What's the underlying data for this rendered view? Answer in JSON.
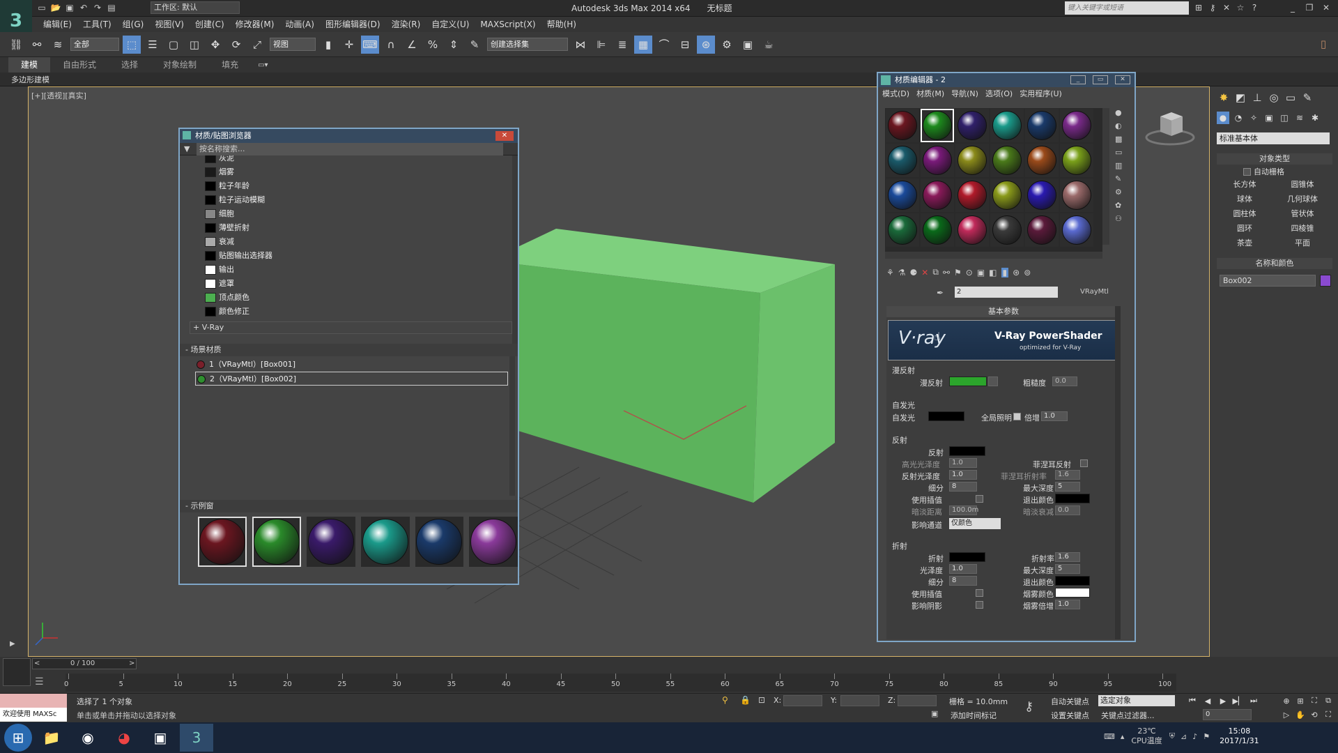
{
  "app": {
    "title": "Autodesk 3ds Max  2014 x64",
    "document": "无标题",
    "workspace": "工作区: 默认",
    "search_placeholder": "键入关键字或短语"
  },
  "menu": [
    "编辑(E)",
    "工具(T)",
    "组(G)",
    "视图(V)",
    "创建(C)",
    "修改器(M)",
    "动画(A)",
    "图形编辑器(D)",
    "渲染(R)",
    "自定义(U)",
    "MAXScript(X)",
    "帮助(H)"
  ],
  "toolbar": {
    "filter_select": "全部",
    "view_select": "视图",
    "named_selection": "创建选择集"
  },
  "ribbon": {
    "tabs": [
      "建模",
      "自由形式",
      "选择",
      "对象绘制",
      "填充"
    ],
    "active": "建模",
    "subtitle": "多边形建模"
  },
  "viewport": {
    "label": "[+][透视][真实]"
  },
  "browser": {
    "title": "材质/贴图浏览器",
    "search_placeholder": "按名称搜索...",
    "maps": [
      {
        "name": "灰泥",
        "swatch": "#111111"
      },
      {
        "name": "烟雾",
        "swatch": "#1a1a1a"
      },
      {
        "name": "粒子年龄",
        "swatch": "#000000"
      },
      {
        "name": "粒子运动模糊",
        "swatch": "#000000"
      },
      {
        "name": "细胞",
        "swatch": "#888888"
      },
      {
        "name": "薄壁折射",
        "swatch": "#000000"
      },
      {
        "name": "衰减",
        "swatch": "#aaaaaa"
      },
      {
        "name": "贴图输出选择器",
        "swatch": "#000000"
      },
      {
        "name": "输出",
        "swatch": "#ffffff"
      },
      {
        "name": "遮罩",
        "swatch": "#ffffff"
      },
      {
        "name": "顶点颜色",
        "swatch": "#4caf50"
      },
      {
        "name": "颜色修正",
        "swatch": "#000000"
      }
    ],
    "vray_group": "+ V-Ray",
    "scene_group": "- 场景材质",
    "scene_materials": [
      {
        "label": "1（VRayMtl）[Box001]",
        "color": "#7a1f2a"
      },
      {
        "label": "2（VRayMtl）[Box002]",
        "color": "#2f8f2f"
      }
    ],
    "sample_group": "- 示例窗",
    "sample_colors": [
      "#6b1620",
      "#2a8a2a",
      "#3a1a6a",
      "#1a9a8a",
      "#1a3a6a",
      "#8a3a9a"
    ]
  },
  "medit": {
    "title": "材质编辑器 - 2",
    "menu": [
      "模式(D)",
      "材质(M)",
      "导航(N)",
      "选项(O)",
      "实用程序(U)"
    ],
    "slots": [
      "#6b1620",
      "#1d8a1d",
      "#30206a",
      "#1a9a8a",
      "#1a3a6a",
      "#7a2a8a",
      "#1a5a6a",
      "#7a1a7a",
      "#8a8a1a",
      "#4a7a1a",
      "#9a4a1a",
      "#7aa01a",
      "#1a4a9a",
      "#8a1a5a",
      "#b01a2a",
      "#8a9a1a",
      "#2a1ab0",
      "#9a6a6a",
      "#1a6a3a",
      "#0a6a1a",
      "#c02a5a",
      "#3a3a3a",
      "#5a1a3a",
      "#5a6ad0"
    ],
    "material_name": "2",
    "material_type": "VRayMtl",
    "rollout_title": "基本参数",
    "banner_brand": "V·ray",
    "banner_title": "V-Ray PowerShader",
    "banner_sub": "optimized for V-Ray",
    "diffuse_group": "漫反射",
    "diffuse_label": "漫反射",
    "diffuse_color": "#2ca52c",
    "roughness_label": "粗糙度",
    "roughness_value": "0.0",
    "self_illum_group": "自发光",
    "self_illum_label": "自发光",
    "gi_label": "全局照明",
    "multiplier_label": "倍增",
    "multiplier_value": "1.0",
    "reflection_group": "反射",
    "reflect_label": "反射",
    "hilight_gloss_label": "高光光泽度",
    "hilight_gloss_value": "1.0",
    "fresnel_label": "菲涅耳反射",
    "fresnel_ior_label": "菲涅耳折射率",
    "fresnel_ior_value": "1.6",
    "refl_gloss_label": "反射光泽度",
    "refl_gloss_value": "1.0",
    "subdivs_label": "细分",
    "subdivs_value": "8",
    "max_depth_label": "最大深度",
    "max_depth_value": "5",
    "use_interp_label": "使用插值",
    "exit_color_label": "退出颜色",
    "dim_dist_label": "暗淡距离",
    "dim_dist_value": "100.0m",
    "dim_falloff_label": "暗淡衰减",
    "dim_falloff_value": "0.0",
    "affect_channels_label": "影响通道",
    "affect_channels_value": "仅颜色",
    "refraction_group": "折射",
    "refract_label": "折射",
    "ior_label": "折射率",
    "ior_value": "1.6",
    "r_gloss_label": "光泽度",
    "r_gloss_value": "1.0",
    "r_max_depth_label": "最大深度",
    "r_max_depth_value": "5",
    "r_subdivs_label": "细分",
    "r_subdivs_value": "8",
    "r_exit_color_label": "退出颜色",
    "r_use_interp_label": "使用插值",
    "fog_color_label": "烟雾颜色",
    "affect_shadows_label": "影响阴影",
    "fog_mult_label": "烟雾倍增",
    "fog_mult_value": "1.0"
  },
  "cmdpanel": {
    "dropdown": "标准基本体",
    "object_type_title": "对象类型",
    "autogrid": "自动栅格",
    "buttons": [
      "长方体",
      "圆锥体",
      "球体",
      "几何球体",
      "圆柱体",
      "管状体",
      "圆环",
      "四棱锥",
      "茶壶",
      "平面"
    ],
    "name_color_title": "名称和颜色",
    "object_name": "Box002",
    "object_color": "#8a4ad0"
  },
  "timeline": {
    "frame": "0 / 100",
    "ticks": [
      "0",
      "5",
      "10",
      "15",
      "20",
      "25",
      "30",
      "35",
      "40",
      "45",
      "50",
      "55",
      "60",
      "65",
      "70",
      "75",
      "80",
      "85",
      "90",
      "95",
      "100"
    ]
  },
  "status": {
    "welcome": "欢迎使用 MAXSc",
    "selection": "选择了 1 个对象",
    "prompt": "单击或单击并拖动以选择对象",
    "x_label": "X:",
    "y_label": "Y:",
    "z_label": "Z:",
    "grid": "栅格 = 10.0mm",
    "auto_key": "自动关键点",
    "set_key": "设置关键点",
    "selected_obj": "选定对象",
    "key_filter": "关键点过滤器...",
    "add_time_tag": "添加时间标记",
    "frame_field": "0"
  },
  "taskbar": {
    "temperature": "23℃",
    "cpu": "CPU温度",
    "time": "15:08",
    "date": "2017/1/31"
  }
}
